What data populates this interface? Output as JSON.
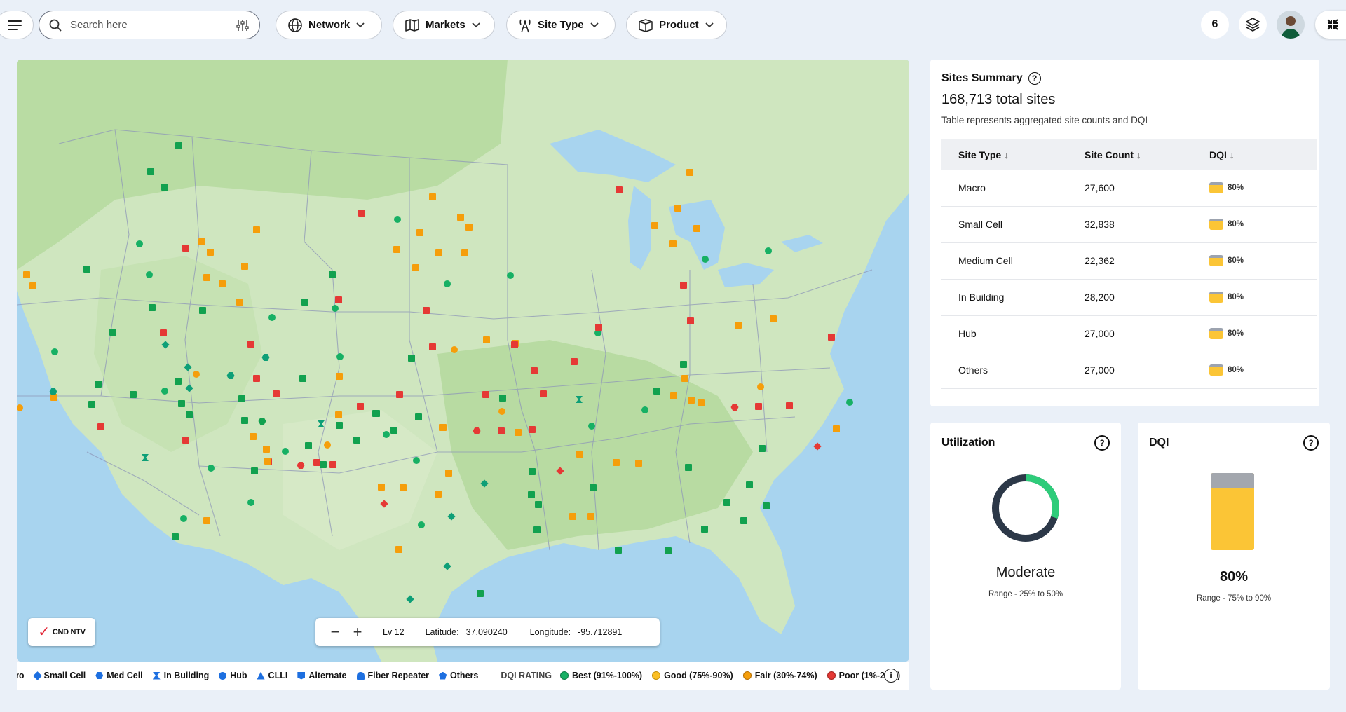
{
  "search": {
    "placeholder": "Search here"
  },
  "filters": [
    {
      "label": "Network",
      "icon": "globe-icon"
    },
    {
      "label": "Markets",
      "icon": "map-icon"
    },
    {
      "label": "Site Type",
      "icon": "tower-icon"
    },
    {
      "label": "Product",
      "icon": "box-icon"
    }
  ],
  "header": {
    "notification_count": "6"
  },
  "map": {
    "logo_text": "CND NTV",
    "zoom_level": "Lv 12",
    "latitude_label": "Latitude:",
    "latitude": "37.090240",
    "longitude_label": "Longitude:",
    "longitude": "-95.712891"
  },
  "legend": {
    "site_types": [
      "ro",
      "Small Cell",
      "Med Cell",
      "In Building",
      "Hub",
      "CLLI",
      "Alternate",
      "Fiber Repeater",
      "Others"
    ],
    "rating_title": "DQI RATING",
    "ratings": [
      {
        "label": "Best (91%-100%)",
        "color": "#17b064"
      },
      {
        "label": "Good (75%-90%)",
        "color": "#fbbf24"
      },
      {
        "label": "Fair (30%-74%)",
        "color": "#f59e0b"
      },
      {
        "label": "Poor (1%-29%)",
        "color": "#e53935"
      }
    ]
  },
  "summary": {
    "title": "Sites Summary",
    "total": "168,713 total sites",
    "subtitle": "Table represents aggregated site counts and DQI",
    "columns": [
      "Site Type",
      "Site Count",
      "DQI"
    ],
    "rows": [
      {
        "type": "Macro",
        "count": "27,600",
        "dqi": "80%"
      },
      {
        "type": "Small Cell",
        "count": "32,838",
        "dqi": "80%"
      },
      {
        "type": "Medium Cell",
        "count": "22,362",
        "dqi": "80%"
      },
      {
        "type": "In Building",
        "count": "28,200",
        "dqi": "80%"
      },
      {
        "type": "Hub",
        "count": "27,000",
        "dqi": "80%"
      },
      {
        "type": "Others",
        "count": "27,000",
        "dqi": "80%"
      }
    ]
  },
  "utilization": {
    "title": "Utilization",
    "status": "Moderate",
    "range": "Range - 25% to 50%",
    "fill_fraction": 0.3
  },
  "dqi": {
    "title": "DQI",
    "value": "80%",
    "range": "Range - 75% to 90%",
    "fill_fraction": 0.8
  },
  "colors": {
    "best": "#17b064",
    "good": "#fbbf24",
    "fair": "#f59e0b",
    "poor": "#e53935",
    "brand": "#1d6fe0"
  }
}
